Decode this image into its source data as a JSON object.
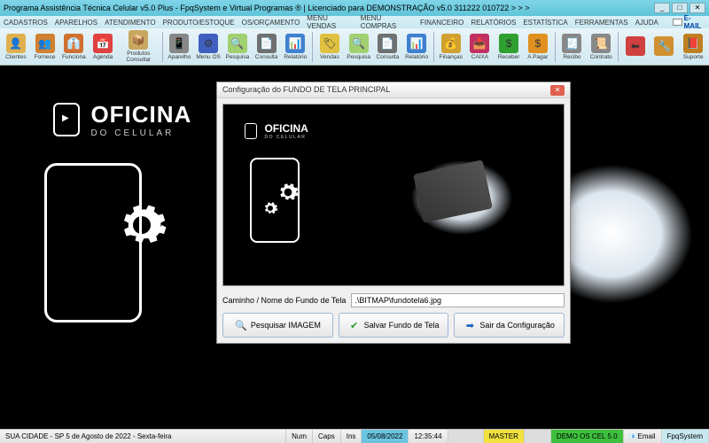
{
  "window": {
    "title": "Programa Assistência Técnica Celular v5.0 Plus - FpqSystem e Virtual Programas ® | Licenciado para  DEMONSTRAÇÃO v5.0 311222 010722 > > >"
  },
  "menu": {
    "items": [
      "CADASTROS",
      "APARELHOS",
      "ATENDIMENTO",
      "PRODUTO/ESTOQUE",
      "OS/ORÇAMENTO",
      "MENU VENDAS",
      "MENU COMPRAS",
      "FINANCEIRO",
      "RELATÓRIOS",
      "ESTATÍSTICA",
      "FERRAMENTAS",
      "AJUDA"
    ],
    "email": "E-MAIL"
  },
  "toolbar": [
    {
      "label": "Clientes",
      "color": "#e0b050",
      "glyph": "👤"
    },
    {
      "label": "Fornece",
      "color": "#d08030",
      "glyph": "👥"
    },
    {
      "label": "Funciona",
      "color": "#d07030",
      "glyph": "👔"
    },
    {
      "label": "Agenda",
      "color": "#e04040",
      "glyph": "📅"
    },
    {
      "label": "Produtos Consultar",
      "color": "#c8a860",
      "glyph": "📦",
      "wide": true
    },
    {
      "sep": true
    },
    {
      "label": "Aparelho",
      "color": "#888",
      "glyph": "📱"
    },
    {
      "label": "Menu OS",
      "color": "#4060c0",
      "glyph": "⚙"
    },
    {
      "label": "Pesquisa",
      "color": "#a0d070",
      "glyph": "🔍"
    },
    {
      "label": "Consulta",
      "color": "#707070",
      "glyph": "📄"
    },
    {
      "label": "Relatório",
      "color": "#4080d0",
      "glyph": "📊"
    },
    {
      "sep": true
    },
    {
      "label": "Vendas",
      "color": "#e0c040",
      "glyph": "🏷"
    },
    {
      "label": "Pesquisa",
      "color": "#a0d070",
      "glyph": "🔍"
    },
    {
      "label": "Consulta",
      "color": "#707070",
      "glyph": "📄"
    },
    {
      "label": "Relatório",
      "color": "#4080d0",
      "glyph": "📊"
    },
    {
      "sep": true
    },
    {
      "label": "Finanças",
      "color": "#d0a030",
      "glyph": "💰"
    },
    {
      "label": "CAIXA",
      "color": "#c03060",
      "glyph": "📥"
    },
    {
      "label": "Receber",
      "color": "#30a030",
      "glyph": "$"
    },
    {
      "label": "A Pagar",
      "color": "#e09020",
      "glyph": "$"
    },
    {
      "sep": true
    },
    {
      "label": "Recibo",
      "color": "#888",
      "glyph": "🧾"
    },
    {
      "label": "Contrato",
      "color": "#888",
      "glyph": "📜"
    },
    {
      "sep": true
    },
    {
      "label": "",
      "color": "#d04040",
      "glyph": "⬅"
    },
    {
      "label": "",
      "color": "#d09030",
      "glyph": "🔧"
    },
    {
      "label": "Suporte",
      "color": "#c08020",
      "glyph": "📕"
    }
  ],
  "background": {
    "logo_main": "OFICINA",
    "logo_sub": "DO CELULAR"
  },
  "dialog": {
    "title": "Configuração do FUNDO DE TELA PRINCIPAL",
    "preview_logo_main": "OFICINA",
    "preview_logo_sub": "DO CELULAR",
    "path_label": "Caminho / Nome do Fundo de Tela",
    "path_value": ".\\BITMAP\\fundotela6.jpg",
    "btn_search": "Pesquisar IMAGEM",
    "btn_save": "Salvar Fundo de Tela",
    "btn_exit": "Sair da Configuração"
  },
  "status": {
    "location": "SUA CIDADE - SP  5 de Agosto de 2022 - Sexta-feira",
    "num": "Num",
    "caps": "Caps",
    "ins": "Ins",
    "date": "05/08/2022",
    "time": "12:35:44",
    "master": "MASTER",
    "demo": "DEMO OS CEL 5.0",
    "email": "Email",
    "brand": "FpqSystem"
  }
}
